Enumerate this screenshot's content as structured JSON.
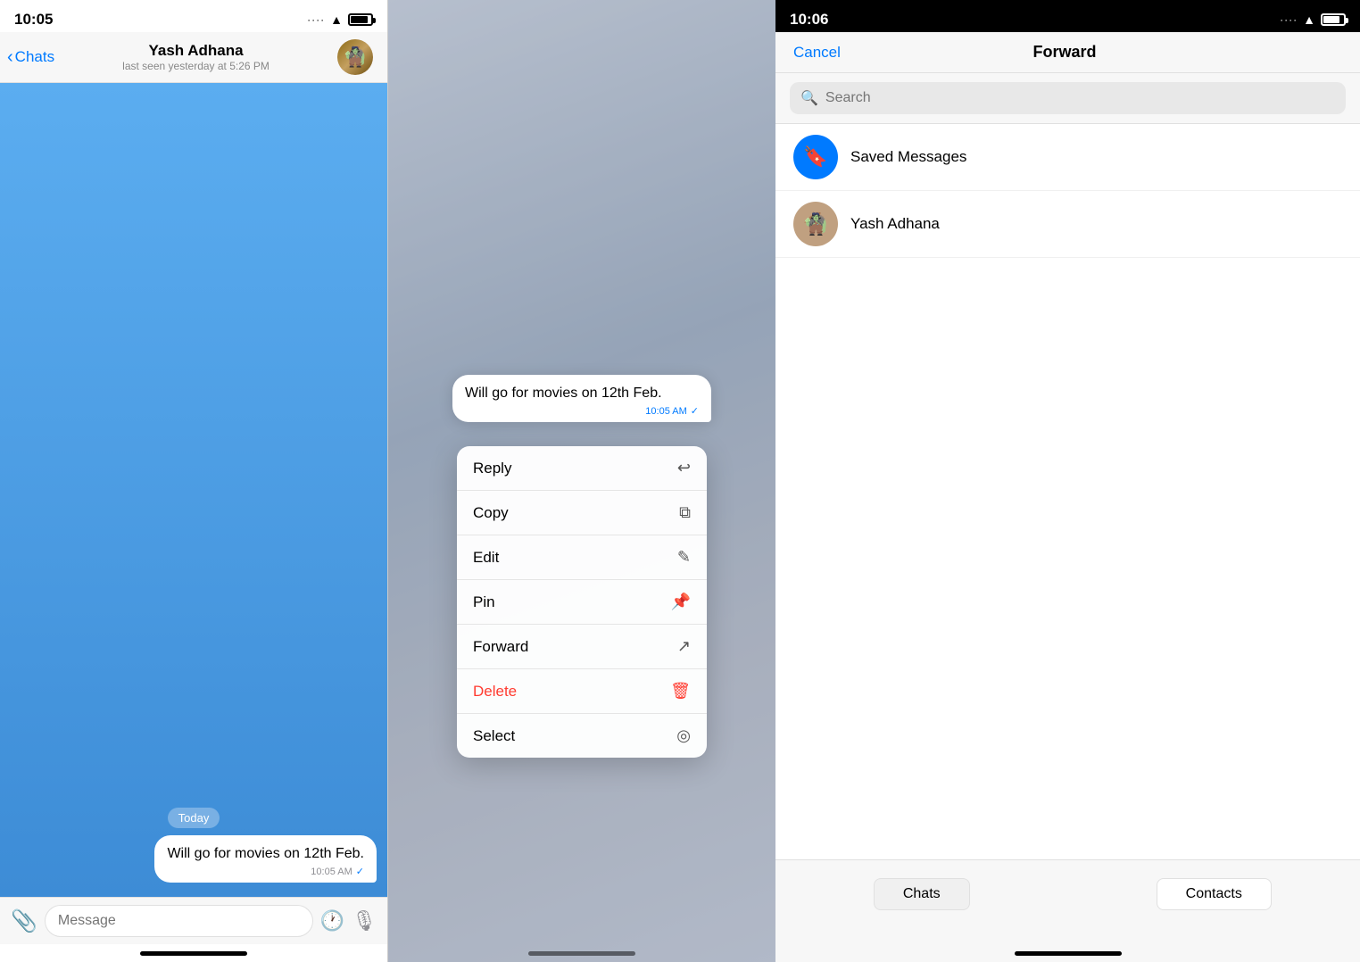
{
  "panel1": {
    "statusTime": "10:05",
    "chatName": "Yash Adhana",
    "chatStatus": "last seen yesterday at 5:26 PM",
    "backLabel": "Chats",
    "dateBadge": "Today",
    "messageText": "Will go for movies on 12th Feb.",
    "messageTime": "10:05 AM",
    "messagePlaceholder": "Message",
    "homeBar": ""
  },
  "panel2": {
    "messageText": "Will go for movies on 12th Feb.",
    "messageTime": "10:05 AM",
    "contextMenu": {
      "items": [
        {
          "label": "Reply",
          "icon": "↩",
          "isDelete": false
        },
        {
          "label": "Copy",
          "icon": "⧉",
          "isDelete": false
        },
        {
          "label": "Edit",
          "icon": "✎",
          "isDelete": false
        },
        {
          "label": "Pin",
          "icon": "📌",
          "isDelete": false
        },
        {
          "label": "Forward",
          "icon": "↗",
          "isDelete": false
        },
        {
          "label": "Delete",
          "icon": "🗑",
          "isDelete": true
        },
        {
          "label": "Select",
          "icon": "◎",
          "isDelete": false
        }
      ]
    }
  },
  "panel3": {
    "statusTime": "10:06",
    "cancelLabel": "Cancel",
    "title": "Forward",
    "searchPlaceholder": "Search",
    "contacts": [
      {
        "id": "saved",
        "name": "Saved Messages",
        "type": "saved"
      },
      {
        "id": "yash",
        "name": "Yash Adhana",
        "type": "person"
      }
    ],
    "tabs": [
      {
        "id": "chats",
        "label": "Chats"
      },
      {
        "id": "contacts",
        "label": "Contacts"
      }
    ]
  }
}
